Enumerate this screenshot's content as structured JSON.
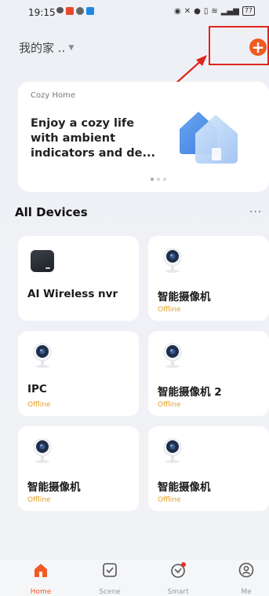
{
  "status_bar": {
    "time": "19:15",
    "battery": "77"
  },
  "header": {
    "home_name": "我的家 ..",
    "add_icon": "plus-circle-icon"
  },
  "banner": {
    "tag": "Cozy Home",
    "text": "Enjoy a cozy life with ambient indicators and de...",
    "page_count": 3,
    "active_page": 1
  },
  "devices_section": {
    "title": "All Devices",
    "more": "···"
  },
  "devices": [
    {
      "name": "AI Wireless nvr",
      "status": "",
      "icon": "nvr-icon"
    },
    {
      "name": "智能摄像机",
      "status": "Offline",
      "icon": "camera-icon"
    },
    {
      "name": "IPC",
      "status": "Offline",
      "icon": "camera-icon"
    },
    {
      "name": "智能摄像机 2",
      "status": "Offline",
      "icon": "camera-icon"
    },
    {
      "name": "智能摄像机",
      "status": "Offline",
      "icon": "camera-icon"
    },
    {
      "name": "智能摄像机",
      "status": "Offline",
      "icon": "camera-icon"
    }
  ],
  "nav": {
    "home": "Home",
    "scene": "Scene",
    "smart": "Smart",
    "me": "Me"
  },
  "colors": {
    "accent": "#f15a22",
    "offline": "#e6a02a",
    "annotation": "#e0251b"
  }
}
